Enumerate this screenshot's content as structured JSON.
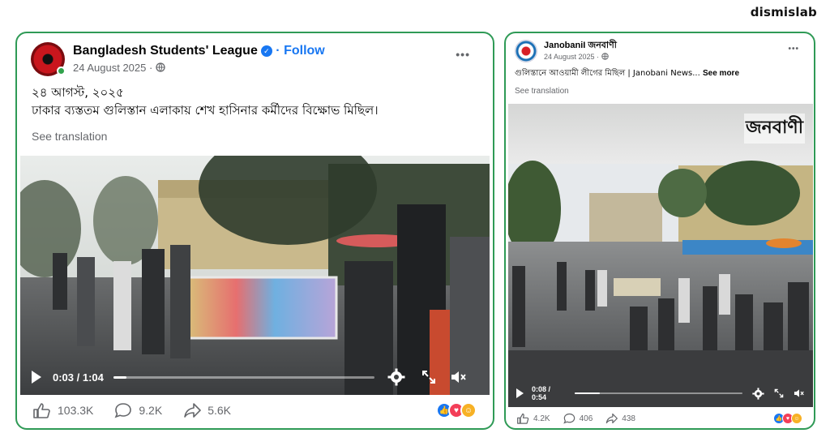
{
  "watermark": "dismislab",
  "post1": {
    "page_name": "Bangladesh Students' League",
    "follow": "· Follow",
    "date": "24 August 2025 ·",
    "menu": "•••",
    "text_line1": "২৪ আগস্ট, ২০২৫",
    "text_line2": "ঢাকার ব্যস্ততম গুলিস্তান এলাকায় শেখ হাসিনার কর্মীদের বিক্ষোভ মিছিল।",
    "see_translation": "See translation",
    "video": {
      "time": "0:03 / 1:04",
      "progress": 0.05
    },
    "likes": "103.3K",
    "comments": "9.2K",
    "shares": "5.6K"
  },
  "post2": {
    "page_name": "JanobaniI জনবাণী",
    "date": "24 August 2025 ·",
    "menu": "•••",
    "text": "গুলিস্তানে আওয়ামী লীগের মিছিল | Janobani News...",
    "see_more": "See more",
    "see_translation": "See translation",
    "brand_logo": "জনবাণী",
    "video": {
      "time": "0:08 / 0:54",
      "progress": 0.15
    },
    "likes": "4.2K",
    "comments": "406",
    "shares": "438"
  },
  "colors": {
    "border": "#2f9a56",
    "facebook_blue": "#1877f2",
    "like": "#1877f2",
    "love": "#f33e58",
    "care": "#f7b125"
  },
  "icons": [
    "verified-icon",
    "globe-icon",
    "play-icon",
    "settings-icon",
    "fullscreen-icon",
    "mute-icon",
    "like-icon",
    "comment-icon",
    "share-icon"
  ]
}
